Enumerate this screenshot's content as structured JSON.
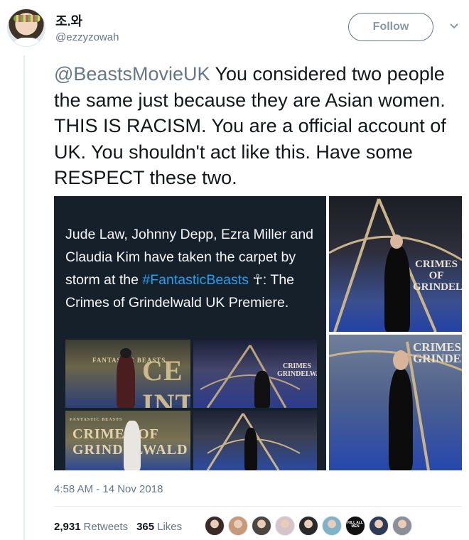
{
  "tweet": {
    "display_name": "조.와",
    "handle": "@ezzyzowah",
    "follow_label": "Follow",
    "text_mention": "@BeastsMovieUK",
    "text_body": " You considered two people the same just because they are Asian women. THIS IS RACISM. You are a official account of UK. You shouldn't act like this. Have some RESPECT these two.",
    "timestamp": "4:58 AM - 14 Nov 2018"
  },
  "media": {
    "embedded_text_part1": "Jude Law, Johnny Depp, Ezra Miller and Claudia Kim have taken the carpet by storm at the ",
    "embedded_hashtag": "#FantasticBeasts",
    "embedded_text_part2": " ☥: The Crimes of Grindelwald UK Premiere.",
    "thumb1_words": "FANTASTIC BEASTS",
    "thumb1_big": "CE INT",
    "thumb2_words": "CRIMES GRINDELWALD",
    "thumb3_words": "CRIMES OF GRINDELWALD",
    "thumb3_small": "FANTASTIC BEASTS",
    "panel_b_words": "CRIMES OF GRINDELWALD",
    "panel_c_words": "CRIMES GRINDELWALD"
  },
  "stats": {
    "retweets_count": "2,931",
    "retweets_label": "Retweets",
    "likes_count": "365",
    "likes_label": "Likes"
  },
  "likers": [
    {
      "color": "#3b2a25",
      "text": ""
    },
    {
      "color": "#c79a7a",
      "text": ""
    },
    {
      "color": "#4b4640",
      "text": ""
    },
    {
      "color": "#d6c4c8",
      "text": ""
    },
    {
      "color": "#2a2a2a",
      "text": ""
    },
    {
      "color": "#7fb3c9",
      "text": ""
    },
    {
      "color": "#111111",
      "text": "KILL ALL MEN"
    },
    {
      "color": "#2e3b57",
      "text": ""
    },
    {
      "color": "#8a8f98",
      "text": ""
    }
  ],
  "colors": {
    "mention": "#657786",
    "hashtag": "#1da1f2",
    "muted": "#657786"
  }
}
